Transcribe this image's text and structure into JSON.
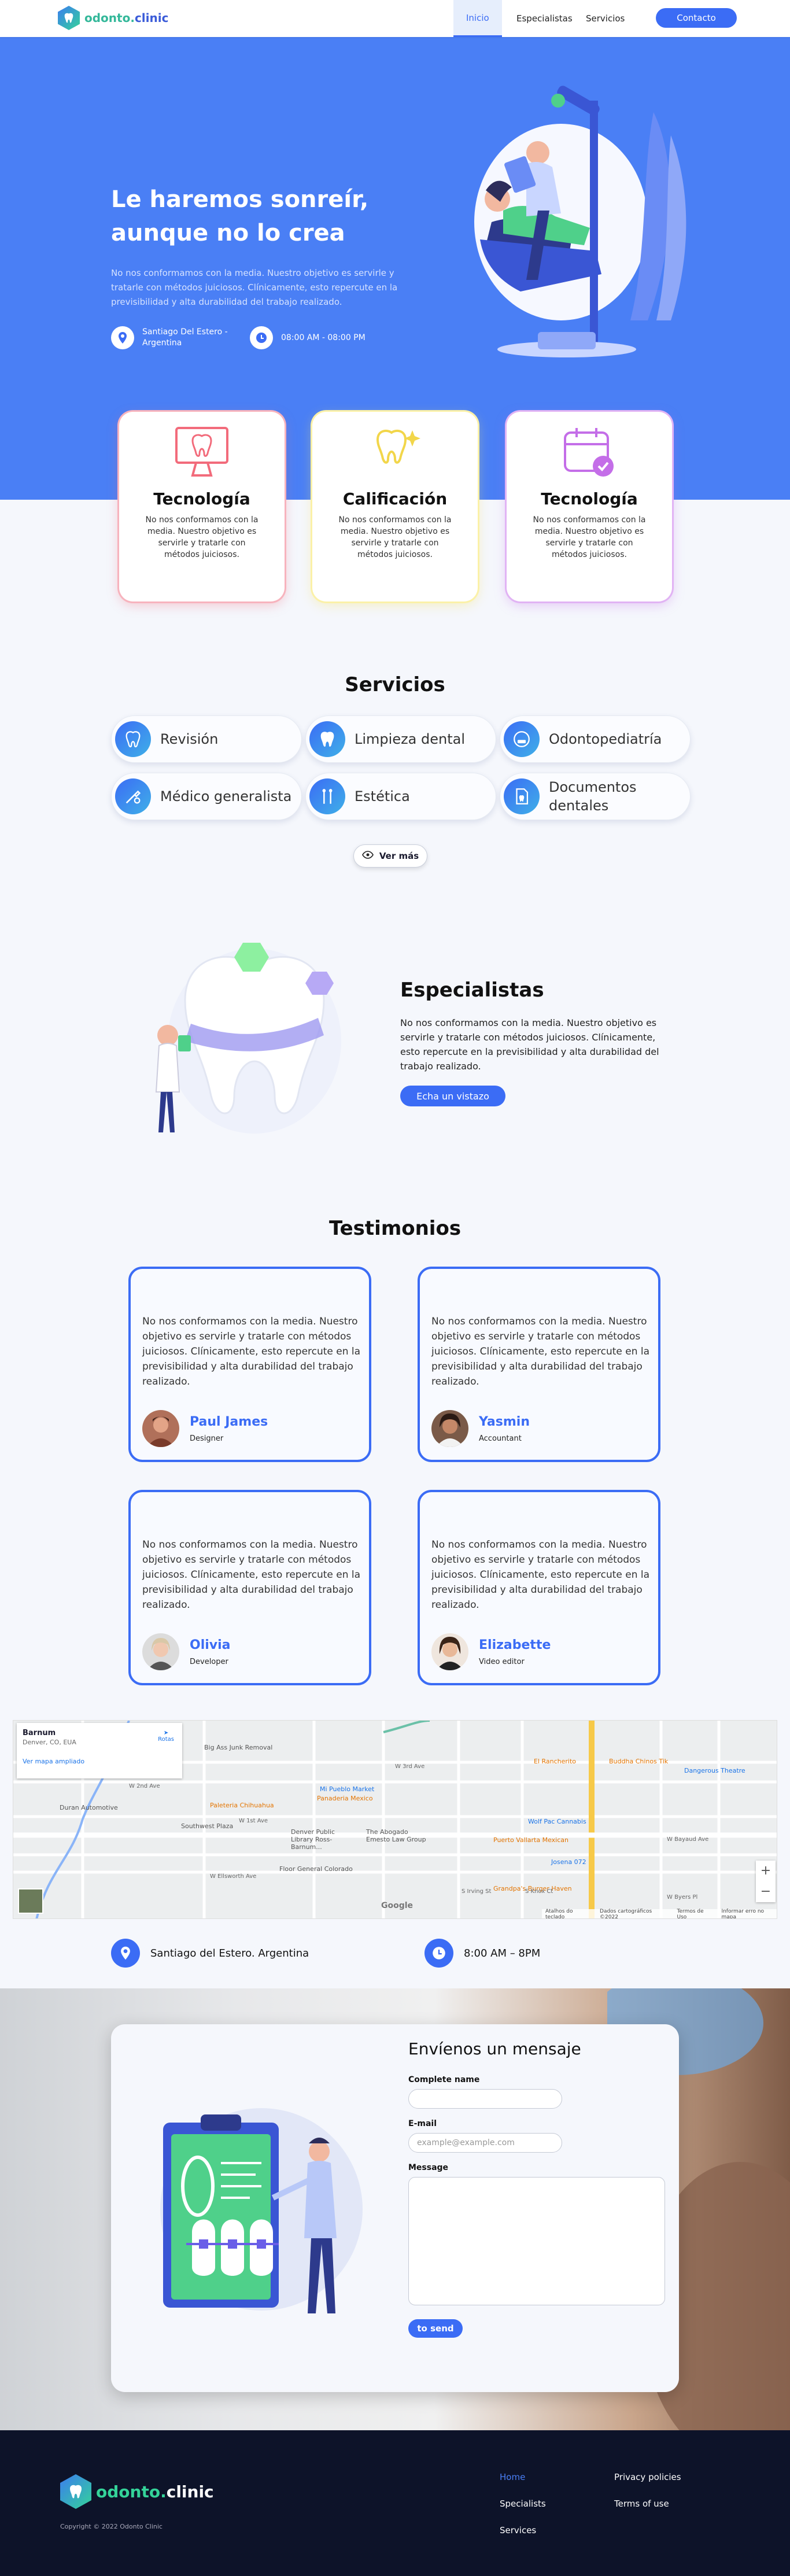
{
  "header": {
    "logo_part1": "odonto.",
    "logo_part2": "clinic",
    "nav": [
      "Inicio",
      "Especialistas",
      "Servicios"
    ],
    "contact": "Contacto"
  },
  "hero": {
    "title": "Le haremos sonreír, aunque no lo crea",
    "text": "No nos conformamos con la media. Nuestro objetivo es servirle y tratarle con métodos juiciosos. Clínicamente, esto repercute en la previsibilidad y alta durabilidad del trabajo realizado.",
    "location": "Santiago Del Estero - Argentina",
    "hours": "08:00 AM - 08:00 PM"
  },
  "features": [
    {
      "title": "Tecnología",
      "text": "No nos conformamos con la media. Nuestro objetivo es servirle y tratarle con métodos juiciosos.",
      "color": "#f26b7b"
    },
    {
      "title": "Calificación",
      "text": "No nos conformamos con la media. Nuestro objetivo es servirle y tratarle con métodos juiciosos.",
      "color": "#f7e46a"
    },
    {
      "title": "Tecnología",
      "text": "No nos conformamos con la media. Nuestro objetivo es servirle y tratarle con métodos juiciosos.",
      "color": "#c46ee8"
    }
  ],
  "services": {
    "title": "Servicios",
    "items": [
      "Revisión",
      "Limpieza dental",
      "Odontopediatría",
      "Médico generalista",
      "Estética",
      "Documentos dentales"
    ],
    "more": "Ver más"
  },
  "specialists": {
    "title": "Especialistas",
    "text": "No nos conformamos con la media. Nuestro objetivo es servirle y tratarle con métodos juiciosos. Clínicamente, esto repercute en la previsibilidad y alta durabilidad del trabajo realizado.",
    "button": "Echa un vistazo"
  },
  "testimonials": {
    "title": "Testimonios",
    "items": [
      {
        "text": "No nos conformamos con la media. Nuestro objetivo es servirle y tratarle con métodos juiciosos. Clínicamente, esto repercute en la previsibilidad y alta durabilidad del trabajo realizado.",
        "name": "Paul James",
        "role": "Designer"
      },
      {
        "text": "No nos conformamos con la media. Nuestro objetivo es servirle y tratarle con métodos juiciosos. Clínicamente, esto repercute en la previsibilidad y alta durabilidad del trabajo realizado.",
        "name": "Yasmin",
        "role": "Accountant"
      },
      {
        "text": "No nos conformamos con la media. Nuestro objetivo es servirle y tratarle con métodos juiciosos. Clínicamente, esto repercute en la previsibilidad y alta durabilidad del trabajo realizado.",
        "name": "Olivia",
        "role": "Developer"
      },
      {
        "text": "No nos conformamos con la media. Nuestro objetivo es servirle y tratarle con métodos juiciosos. Clínicamente, esto repercute en la previsibilidad y alta durabilidad del trabajo realizado.",
        "name": "Elizabette",
        "role": "Video editor"
      }
    ]
  },
  "map": {
    "place_name": "Barnum",
    "place_address": "Denver, CO, EUA",
    "directions": "Rotas",
    "larger_map": "Ver mapa ampliado",
    "labels": [
      "Big Ass Junk Removal",
      "Mi Pueblo Market",
      "Panaderia Mexico",
      "Paleteria Chihuahua",
      "Southwest Plaza",
      "Duran Automotive",
      "Denver Public Library Ross-Barnum...",
      "The Abogado Emesto Law Group",
      "Floor General Colorado",
      "El Rancherito",
      "Buddha Chinos Tik",
      "Dangerous Theatre",
      "Wolf Pac Cannabis",
      "Puerto Vallarta Mexican",
      "Josena 072",
      "Grandpa's Burger Haven",
      "W 3rd Ave",
      "W 2nd Ave",
      "W 1st Ave",
      "W Ellsworth Ave",
      "W Bayaud Ave",
      "W Byers Pl",
      "S Irving St",
      "S Knox Ct"
    ],
    "footer": [
      "Atalhos do teclado",
      "Dados cartográficos ©2022",
      "Termos de Uso",
      "Informar erro no mapa"
    ],
    "google": "Google"
  },
  "address": {
    "location": "Santiago del Estero. Argentina",
    "hours": "8:00 AM – 8PM"
  },
  "contact": {
    "title": "Envíenos un mensaje",
    "name_label": "Complete name",
    "email_label": "E-mail",
    "email_placeholder": "example@example.com",
    "message_label": "Message",
    "send": "to send"
  },
  "footer": {
    "copyright": "Copyright © 2022 Odonto Clinic",
    "links": [
      "Home",
      "Specialists",
      "Services",
      "Privacy policies",
      "Terms of use"
    ]
  },
  "colors": {
    "primary": "#3b6cf5",
    "hero": "#4a7ff5",
    "footer": "#0d1329",
    "teal": "#34b89a"
  }
}
